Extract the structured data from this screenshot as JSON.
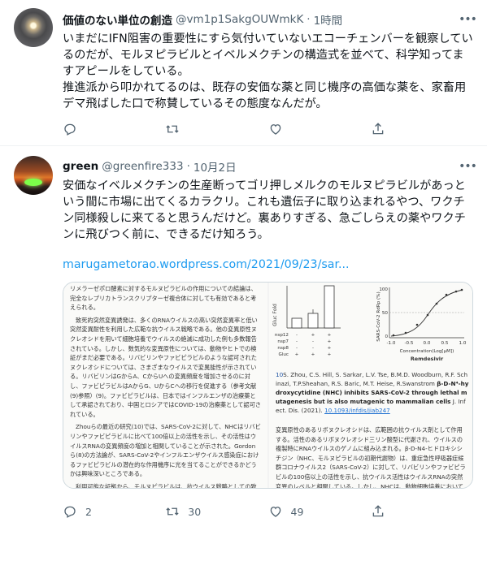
{
  "tweets": [
    {
      "name": "価値のない単位の創造",
      "handle": "@vm1p1SakgOUWmkK",
      "time": "1時間",
      "text": [
        "いまだにIFN阻害の重要性にすら気付いていないエコーチェンバーを観察しているのだが、モルヌピラビルとイベルメクチンの構造式を並べて、科学知ってますアピールをしている。",
        "推進派から叩かれてるのは、既存の安価な薬と同じ機序の高価な薬を、家畜用デマ飛ばした口で称賛しているその態度なんだが。"
      ],
      "actions": {
        "reply": "",
        "retweet": "",
        "like": "",
        "share": ""
      }
    },
    {
      "name": "green",
      "handle": "@greenfire333",
      "time": "10月2日",
      "text": [
        "安価なイベルメクチンの生産断ってゴリ押しメルクのモルヌピラビルがあっという間に市場に出てくるカラクリ。これも遺伝子に取り込まれるやつ、ワクチン同様殺しに来てると思うんだけど。裏ありすぎる、急ごしらえの薬やワクチンに飛びつく前に、できるだけ知ろう。"
      ],
      "link": "marugametorao.wordpress.com/2021/09/23/sar...",
      "actions": {
        "reply": "2",
        "retweet": "30",
        "like": "49",
        "share": ""
      },
      "image": {
        "left_paragraphs": [
          "リメラーゼポロ酵素に対するモルヌピラビルの作用についての結論は、完全なレプリカトランスクリプターゼ複合体に対しても有効であると考えられる。",
          "致死的突然変異誘発は、多くのRNAウイルスの高い突然変異率と低い突然変異耐性を利用した広範な抗ウイルス戦略である。他の変異原性ヌクレオシドを用いて細胞培養でウイルスの絶滅に成功した例も多数報告されている。しかし、数気的な変異原性については、動物やヒトでの検証がまだ必要である。リバビリンやファビピラビルのような認可されたヌクレオシドについては、さまざまなウイルスで変異能性が示されている。リバビリンはGからA、CからUへの変異頻度を増加させるのに対し、ファビピラビルはAからG、UからCへの移行を促進する（参考文献(9)参照）(9)。ファビピラビルは、日本ではインフルエンザの治療薬として承認されており、中国とロシアではCOVID-19の治療薬として認可されている。",
          "Zhouらの最近の研究(10)では、SARS-CoV-2に対して、NHCはリバビリンやファビピラビルに比べて100倍以上の活性を示し、その活性はウイルスRNAの変異頻度の増加と相関していることが示された。Gordonら(8)の方法論が、SARS-CoV-2やインフルエンザウイルス感染症におけるファビピラビルの潜在的な作用機序に光を当てることができるかどうかは興味深いところである。",
          "利用可能な証拠から、モルヌピラビルは、抗ウイルス戦略としての致死的突然変異誘発の使用におけるパラダイムの例となる可能"
        ],
        "ref_number": "10",
        "ref_authors": "S. Zhou, C.S. Hill, S. Sarkar, L.V. Tse, B.M.D. Woodburn, R.F. Schinazi, T.P.Sheahan, R.S. Baric, M.T. Heise, R.Swanstrom",
        "ref_title": "β-D-N⁴-hydroxycytidine (NHC) inhibits SARS-CoV-2 through lethal mutagenesis but is also mutagenic to mammalian cells",
        "ref_journal": "J. Infect. Dis. (2021).",
        "ref_doi": "10.1093/infdis/jiab247",
        "right_paragraphs": [
          "変異原性のあるリボヌクレオシドは、広範囲の抗ウイルス剤として作用する。活性のあるリボヌクレオシド三リン酸型に代謝され、ウイルスの複製時にRNAウイルスのゲノムに組み込まれる。β-D-N4-ヒドロキシシチジン（NHC、モルヌピラビルの初期代謝物）は、重症急性呼吸器症候群コロナウイルス2（SARS-CoV-2）に対して、リバビリンやファビピラビルの100倍以上の活性を示し、抗ウイルス活性はウイルスRNAの突然変異のレベルと相関している。しかし、NHCは、動物細胞培養においても宿主の変異活性を示し、RNAとDNAの前駆体がリボヌクレオシド二"
        ],
        "figure": {
          "bar_ylabel": "Gluc Fold",
          "bar_rows": [
            "nsp12",
            "nsp7",
            "nsp8",
            "Gluc"
          ],
          "bar_signs": [
            [
              "-",
              "+",
              "+"
            ],
            [
              "-",
              "-",
              "+"
            ],
            [
              "-",
              "-",
              "+"
            ],
            [
              "+",
              "+",
              "+"
            ]
          ],
          "curve_ylabel": "SARS-CoV-2 RdRp (%)",
          "curve_xlabel": "Concentration(Log[μM])",
          "curve_title": "Remdesivir",
          "curve_xticks": [
            "-1.0",
            "-0.5",
            "0.0",
            "0.5",
            "1.0"
          ],
          "curve_yticks": [
            "100",
            "50",
            "0"
          ]
        }
      }
    }
  ]
}
